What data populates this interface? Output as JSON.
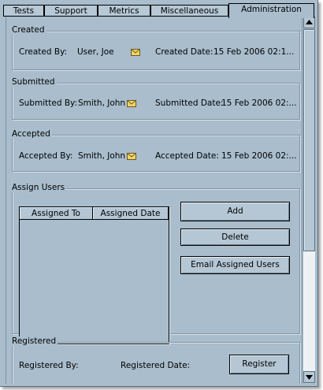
{
  "tabs": [
    "Tests",
    "Support",
    "Metrics",
    "Miscellaneous",
    "Administration"
  ],
  "active_tab": "Administration",
  "created": {
    "title": "Created",
    "by_label": "Created By:",
    "by_value": "User, Joe",
    "date_label": "Created Date:",
    "date_value": "15 Feb 2006 02:1..."
  },
  "submitted": {
    "title": "Submitted",
    "by_label": "Submitted By:",
    "by_value": "Smith, John",
    "date_label": "Submitted Date:",
    "date_value": "15 Feb 2006 02:..."
  },
  "accepted": {
    "title": "Accepted",
    "by_label": "Accepted By:",
    "by_value": "Smith, John",
    "date_label": "Accepted Date:",
    "date_value": "15 Feb 2006 02:..."
  },
  "assign_users": {
    "title": "Assign Users",
    "columns": [
      "Assigned To",
      "Assigned Date"
    ],
    "rows": [],
    "add_label": "Add",
    "delete_label": "Delete",
    "email_label": "Email Assigned Users"
  },
  "registered": {
    "title": "Registered",
    "by_label": "Registered By:",
    "date_label": "Registered Date:",
    "register_label": "Register"
  },
  "icons": {
    "mail": "envelope-icon"
  },
  "colors": {
    "panel": "#a9bdcc",
    "button": "#b5c7d5",
    "envelope": "#f2d36a"
  }
}
